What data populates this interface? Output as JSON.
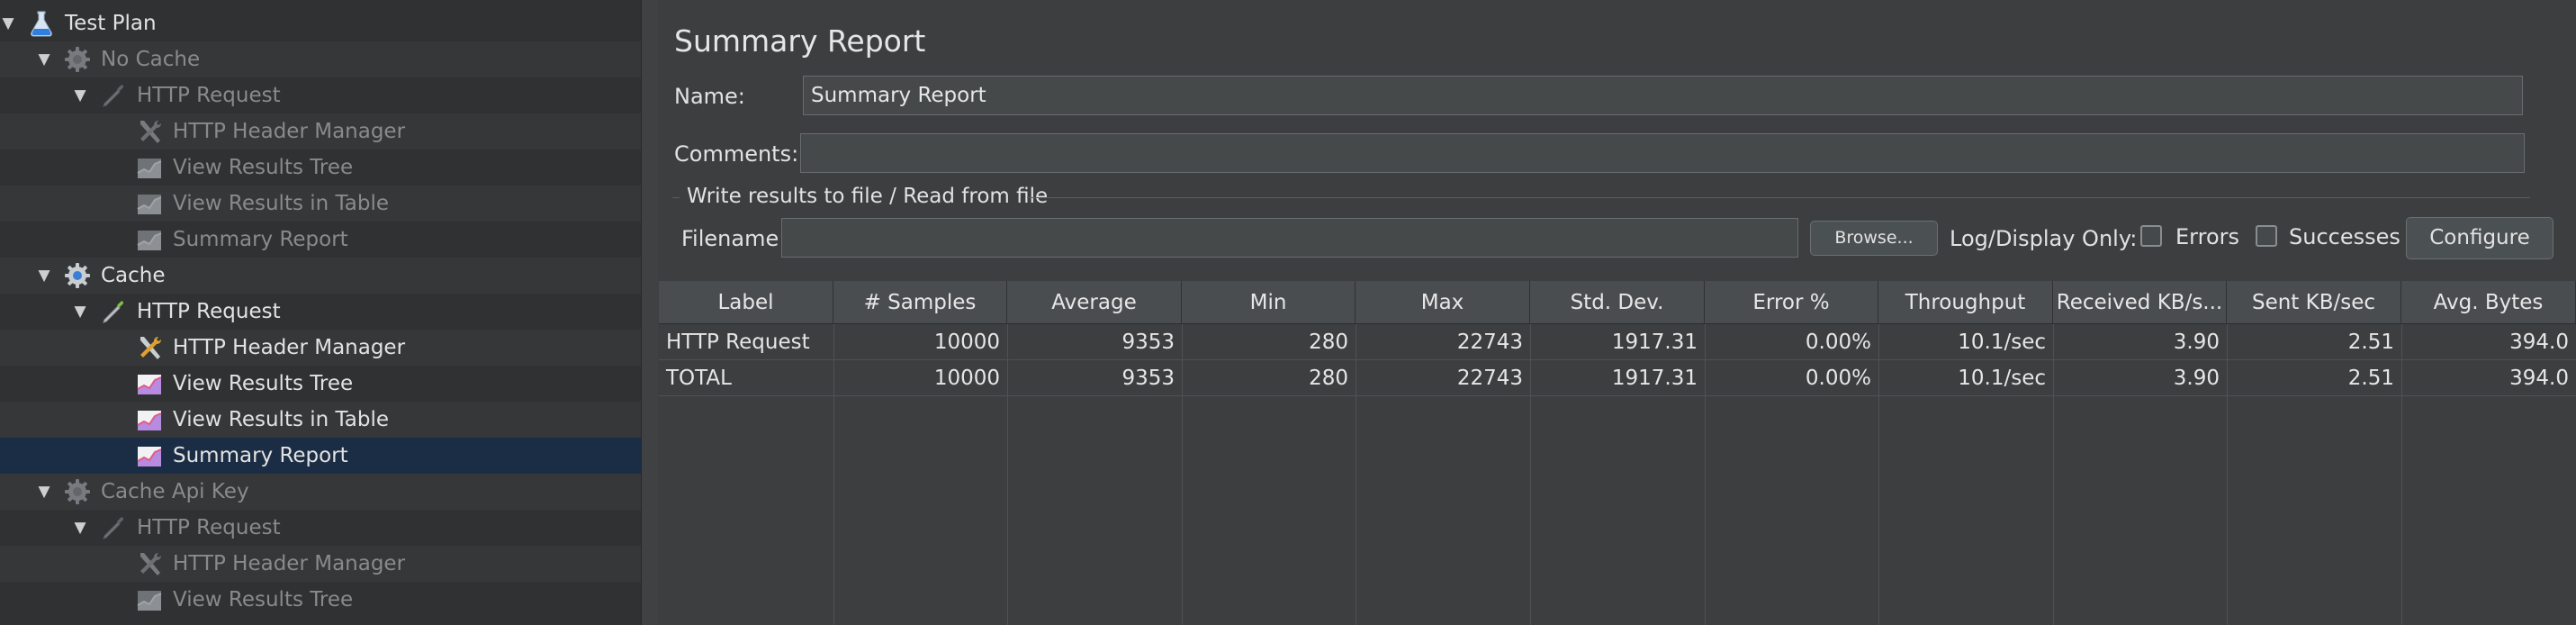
{
  "tree": [
    {
      "label": "Test Plan",
      "indent": 0,
      "icon": "flask",
      "twisty": "expanded",
      "disabled": false,
      "selected": false
    },
    {
      "label": "No Cache",
      "indent": 1,
      "icon": "gear",
      "twisty": "expanded",
      "disabled": true,
      "selected": false
    },
    {
      "label": "HTTP Request",
      "indent": 2,
      "icon": "pipette",
      "twisty": "expanded",
      "disabled": true,
      "selected": false
    },
    {
      "label": "HTTP Header Manager",
      "indent": 3,
      "icon": "tools",
      "twisty": "none",
      "disabled": true,
      "selected": false
    },
    {
      "label": "View Results Tree",
      "indent": 3,
      "icon": "graph",
      "twisty": "none",
      "disabled": true,
      "selected": false
    },
    {
      "label": "View Results in Table",
      "indent": 3,
      "icon": "graph",
      "twisty": "none",
      "disabled": true,
      "selected": false
    },
    {
      "label": "Summary Report",
      "indent": 3,
      "icon": "graph",
      "twisty": "none",
      "disabled": true,
      "selected": false
    },
    {
      "label": "Cache",
      "indent": 1,
      "icon": "gear",
      "twisty": "expanded",
      "disabled": false,
      "selected": false
    },
    {
      "label": "HTTP Request",
      "indent": 2,
      "icon": "pipette",
      "twisty": "expanded",
      "disabled": false,
      "selected": false
    },
    {
      "label": "HTTP Header Manager",
      "indent": 3,
      "icon": "tools",
      "twisty": "none",
      "disabled": false,
      "selected": false
    },
    {
      "label": "View Results Tree",
      "indent": 3,
      "icon": "graph",
      "twisty": "none",
      "disabled": false,
      "selected": false
    },
    {
      "label": "View Results in Table",
      "indent": 3,
      "icon": "graph",
      "twisty": "none",
      "disabled": false,
      "selected": false
    },
    {
      "label": "Summary Report",
      "indent": 3,
      "icon": "graph",
      "twisty": "none",
      "disabled": false,
      "selected": true
    },
    {
      "label": "Cache Api Key",
      "indent": 1,
      "icon": "gear",
      "twisty": "expanded",
      "disabled": true,
      "selected": false
    },
    {
      "label": "HTTP Request",
      "indent": 2,
      "icon": "pipette",
      "twisty": "expanded",
      "disabled": true,
      "selected": false
    },
    {
      "label": "HTTP Header Manager",
      "indent": 3,
      "icon": "tools",
      "twisty": "none",
      "disabled": true,
      "selected": false
    },
    {
      "label": "View Results Tree",
      "indent": 3,
      "icon": "graph",
      "twisty": "none",
      "disabled": true,
      "selected": false
    }
  ],
  "panel": {
    "title": "Summary Report",
    "name_label": "Name:",
    "name_value": "Summary Report",
    "comments_label": "Comments:",
    "comments_value": "",
    "fieldset_legend": "Write results to file / Read from file",
    "filename_label": "Filename",
    "filename_value": "",
    "browse_label": "Browse...",
    "log_display_label": "Log/Display Only:",
    "errors_label": "Errors",
    "errors_checked": false,
    "successes_label": "Successes",
    "successes_checked": false,
    "configure_label": "Configure"
  },
  "table": {
    "columns": [
      "Label",
      "# Samples",
      "Average",
      "Min",
      "Max",
      "Std. Dev.",
      "Error %",
      "Throughput",
      "Received KB/s...",
      "Sent KB/sec",
      "Avg. Bytes"
    ],
    "rows": [
      [
        "HTTP Request",
        "10000",
        "9353",
        "280",
        "22743",
        "1917.31",
        "0.00%",
        "10.1/sec",
        "3.90",
        "2.51",
        "394.0"
      ],
      [
        "TOTAL",
        "10000",
        "9353",
        "280",
        "22743",
        "1917.31",
        "0.00%",
        "10.1/sec",
        "3.90",
        "2.51",
        "394.0"
      ]
    ]
  },
  "colors": {
    "tree_bg": "#2f3133",
    "selection": "#1b2d44",
    "panel_bg": "#3c3e40",
    "header_bg": "#4a4d50",
    "text": "#e6e6e6",
    "disabled_text": "#8a8a8a"
  }
}
